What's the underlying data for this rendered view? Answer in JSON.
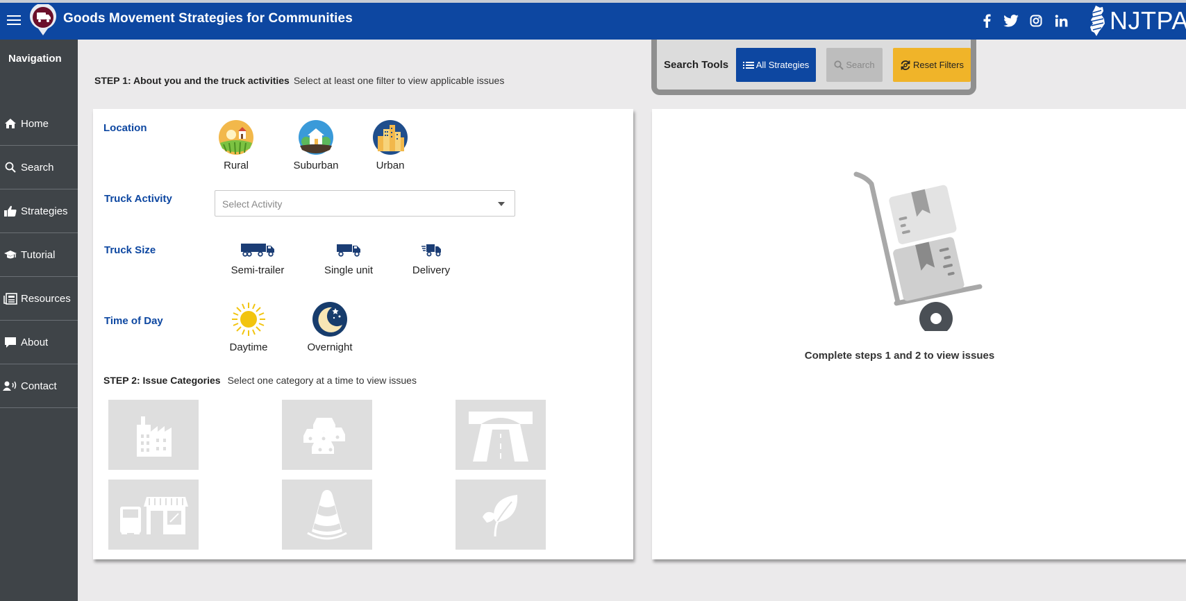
{
  "header": {
    "title": "Goods Movement Strategies for Communities",
    "brand": "NJTPA",
    "social": [
      "facebook-icon",
      "twitter-icon",
      "instagram-icon",
      "linkedin-icon"
    ]
  },
  "sidebar": {
    "title": "Navigation",
    "items": [
      {
        "label": "Home",
        "icon": "home-icon"
      },
      {
        "label": "Search",
        "icon": "search-icon"
      },
      {
        "label": "Strategies",
        "icon": "thumbs-up-icon"
      },
      {
        "label": "Tutorial",
        "icon": "graduation-cap-icon"
      },
      {
        "label": "Resources",
        "icon": "newspaper-icon"
      },
      {
        "label": "About",
        "icon": "comment-icon"
      },
      {
        "label": "Contact",
        "icon": "contact-icon"
      }
    ]
  },
  "step1": {
    "title": "STEP 1: About you and the truck activities",
    "hint": "Select at least one filter to view applicable issues"
  },
  "search_tools": {
    "label": "Search Tools",
    "all_strategies": "All Strategies",
    "search": "Search",
    "reset": "Reset Filters"
  },
  "filters": {
    "location": {
      "label": "Location",
      "options": [
        "Rural",
        "Suburban",
        "Urban"
      ]
    },
    "truck_activity": {
      "label": "Truck Activity",
      "placeholder": "Select Activity"
    },
    "truck_size": {
      "label": "Truck Size",
      "options": [
        "Semi-trailer",
        "Single unit",
        "Delivery"
      ]
    },
    "time_of_day": {
      "label": "Time of Day",
      "options": [
        "Daytime",
        "Overnight"
      ]
    }
  },
  "step2": {
    "title": "STEP 2: Issue Categories",
    "hint": "Select one category at a time to view issues",
    "categories": [
      "industrial-building-icon",
      "traffic-congestion-icon",
      "roadway-icon",
      "delivery-storefront-icon",
      "traffic-cone-icon",
      "leaf-icon"
    ]
  },
  "results": {
    "empty_message": "Complete steps 1 and 2 to view issues"
  },
  "colors": {
    "header": "#0d47a1",
    "sidebar": "#3f4448",
    "accent_yellow": "#f0b429",
    "label_blue": "#0d47a1"
  }
}
